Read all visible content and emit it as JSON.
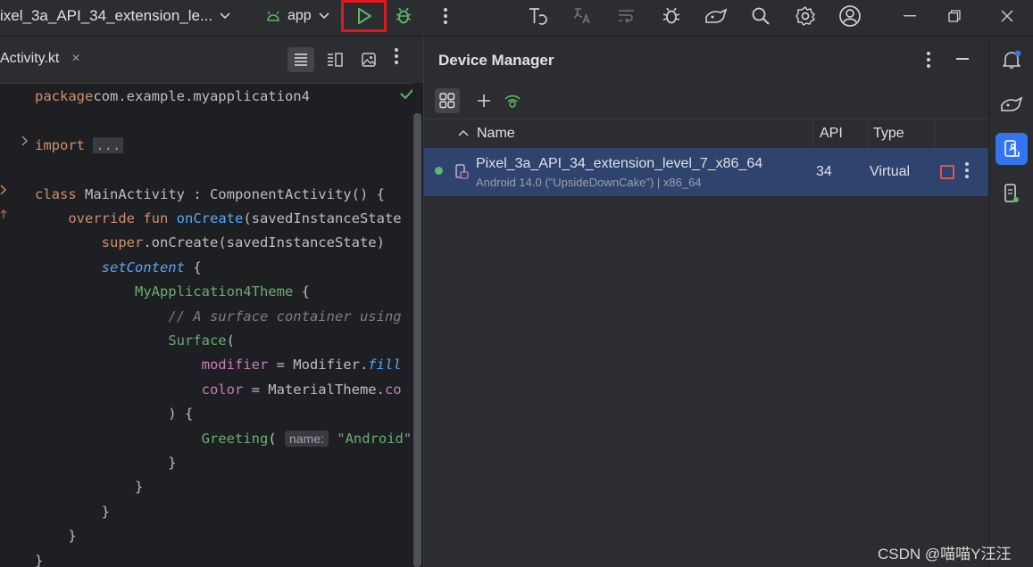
{
  "titlebar": {
    "device_selector": "ixel_3a_API_34_extension_le...",
    "run_config": "app",
    "icons": [
      "android-icon",
      "chevron-down-icon",
      "run-icon",
      "debug-icon",
      "more-vertical-icon",
      "profiler-icon",
      "translate-icon",
      "apply-changes-icon",
      "bug-icon",
      "device-mirror-icon",
      "search-icon",
      "gear-icon",
      "account-icon",
      "minimize-icon",
      "restore-icon",
      "close-icon"
    ]
  },
  "editor": {
    "tab_label": "Activity.kt",
    "tab_close": "×",
    "code": [
      {
        "parts": [
          [
            "kw",
            "package"
          ],
          [
            "",
            "com.example.myapplication4"
          ]
        ]
      },
      {
        "parts": []
      },
      {
        "parts": [
          [
            "kw",
            "import "
          ],
          [
            "fold",
            "..."
          ]
        ]
      },
      {
        "parts": []
      },
      {
        "parts": [
          [
            "kw",
            "class "
          ],
          [
            "",
            "MainActivity : ComponentActivity() {"
          ]
        ]
      },
      {
        "parts": [
          [
            "",
            "    "
          ],
          [
            "kw",
            "override fun "
          ],
          [
            "fn",
            "onCreate"
          ],
          [
            "",
            "(savedInstanceState"
          ]
        ]
      },
      {
        "parts": [
          [
            "",
            "        "
          ],
          [
            "kw",
            "super"
          ],
          [
            "",
            ".onCreate(savedInstanceState)"
          ]
        ]
      },
      {
        "parts": [
          [
            "",
            "        "
          ],
          [
            "fni",
            "setContent"
          ],
          [
            "",
            " {"
          ]
        ]
      },
      {
        "parts": [
          [
            "",
            "            "
          ],
          [
            "cls",
            "MyApplication4Theme"
          ],
          [
            "",
            " {"
          ]
        ]
      },
      {
        "parts": [
          [
            "",
            "                "
          ],
          [
            "cmt",
            "// A surface container using"
          ]
        ]
      },
      {
        "parts": [
          [
            "",
            "                "
          ],
          [
            "cls",
            "Surface"
          ],
          [
            "",
            "("
          ]
        ]
      },
      {
        "parts": [
          [
            "",
            "                    "
          ],
          [
            "prop",
            "modifier"
          ],
          [
            "",
            " = Modifier."
          ],
          [
            "fni",
            "fill"
          ]
        ]
      },
      {
        "parts": [
          [
            "",
            "                    "
          ],
          [
            "prop",
            "color"
          ],
          [
            "",
            " = MaterialTheme."
          ],
          [
            "prop",
            "co"
          ]
        ]
      },
      {
        "parts": [
          [
            "",
            "                ) {"
          ]
        ]
      },
      {
        "parts": [
          [
            "",
            "                    "
          ],
          [
            "cls",
            "Greeting"
          ],
          [
            "",
            "( "
          ],
          [
            "hint",
            "name:"
          ],
          [
            "",
            " "
          ],
          [
            "str",
            "\"Android\""
          ]
        ]
      },
      {
        "parts": [
          [
            "",
            "                }"
          ]
        ]
      },
      {
        "parts": [
          [
            "",
            "            }"
          ]
        ]
      },
      {
        "parts": [
          [
            "",
            "        }"
          ]
        ]
      },
      {
        "parts": [
          [
            "",
            "    }"
          ]
        ]
      },
      {
        "parts": [
          [
            "",
            "}"
          ]
        ]
      }
    ]
  },
  "device_manager": {
    "title": "Device Manager",
    "columns": [
      "Name",
      "API",
      "Type"
    ],
    "devices": [
      {
        "name": "Pixel_3a_API_34_extension_level_7_x86_64",
        "subtitle": "Android 14.0 (\"UpsideDownCake\") | x86_64",
        "api": "34",
        "type": "Virtual",
        "status": "running"
      }
    ]
  },
  "watermark": "CSDN @喵喵Y汪汪",
  "colors": {
    "accent": "#3574f0",
    "run_highlight": "#e0191f",
    "running_dot": "#5fb865",
    "selected_row": "#2e436e"
  }
}
